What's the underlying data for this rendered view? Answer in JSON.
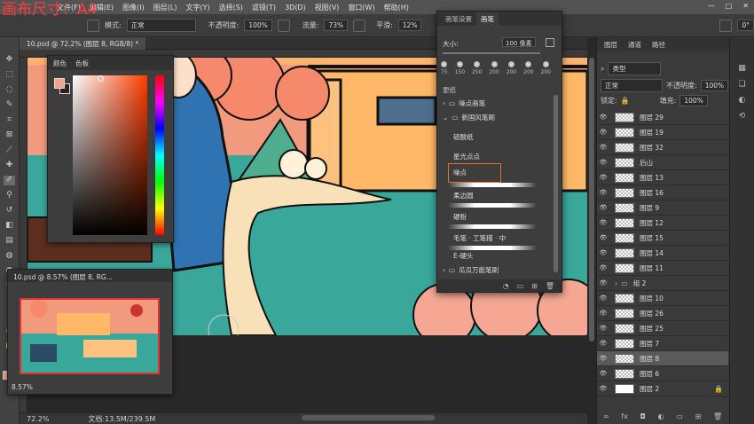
{
  "overlay_label": "画布尺寸：A4",
  "menu": [
    "文件(F)",
    "编辑(E)",
    "图像(I)",
    "图层(L)",
    "文字(Y)",
    "选择(S)",
    "滤镜(T)",
    "3D(D)",
    "视图(V)",
    "窗口(W)",
    "帮助(H)"
  ],
  "window_controls": [
    "—",
    "□",
    "✕"
  ],
  "options": {
    "mode_label": "模式:",
    "mode_value": "正常",
    "opacity_label": "不透明度:",
    "opacity_value": "100%",
    "flow_label": "流量:",
    "flow_value": "73%",
    "smooth_label": "平滑:",
    "smooth_value": "12%",
    "angle_value": "0°"
  },
  "document": {
    "tab_title": "10.psd @ 72.2% (图层 8, RGB/8) *",
    "status_zoom": "72.2%",
    "status_doc": "文档:13.5M/239.5M"
  },
  "color_panel": {
    "tabs": [
      "颜色",
      "色板"
    ],
    "fg_color": "#f3a38a",
    "bg_color": "#2d1f1f"
  },
  "navigator": {
    "title": "10.psd @ 8.57% (图层 8, RG...",
    "zoom": "8.57%"
  },
  "brush_panel": {
    "tabs": [
      "画笔设置",
      "画笔"
    ],
    "size_label": "大小:",
    "size_value": "100 像素",
    "presets": [
      "75",
      "150",
      "250",
      "200",
      "200",
      "200",
      "200"
    ],
    "groups": [
      {
        "name": "噪点画笔",
        "expanded": false
      },
      {
        "name": "新国风笔刷",
        "expanded": true
      },
      {
        "name": "瓜瓜万能笔刷",
        "expanded": false
      }
    ],
    "top_row": "更纸",
    "brushes": [
      "硫酸纸",
      "星光点点",
      "噪点",
      "柔边圆",
      "硬粉",
      "毛笔 · 工笔描 · 中",
      "E-硬头"
    ],
    "selected_brush": "噪点"
  },
  "layers_panel": {
    "tabs": [
      "图层",
      "通道",
      "路径"
    ],
    "filter_label": "类型",
    "blend_mode": "正常",
    "opacity_label": "不透明度:",
    "opacity_value": "100%",
    "lock_label": "锁定:",
    "fill_label": "填充:",
    "fill_value": "100%",
    "layers": [
      "图层 29",
      "图层 19",
      "图层 32",
      "后山",
      "图层 13",
      "图层 16",
      "图层 9",
      "图层 12",
      "图层 15",
      "图层 14",
      "图层 11",
      "组 2",
      "图层 10",
      "图层 26",
      "图层 25",
      "图层 7",
      "图层 8",
      "图层 6",
      "图层 2"
    ],
    "selected_layer": "图层 8"
  }
}
